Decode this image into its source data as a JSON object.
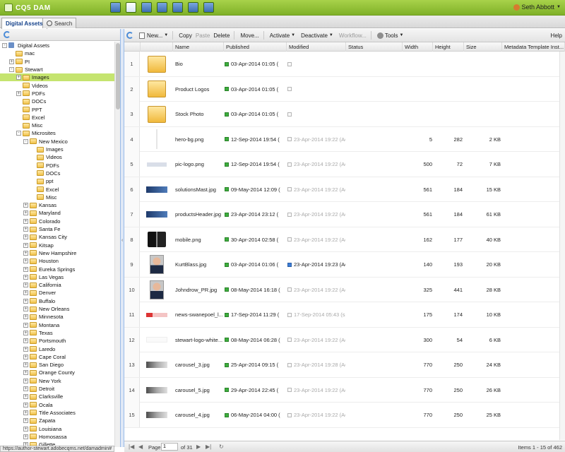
{
  "header": {
    "logo_text": "CQ5 DAM",
    "app_icons": [
      "welcome-icon",
      "dam-icon",
      "workflow-icon",
      "mail-icon",
      "images-icon",
      "tools-icon",
      "tags-icon"
    ],
    "user_name": "Seth Abbott"
  },
  "tabs": [
    {
      "label": "Digital Assets",
      "active": true
    },
    {
      "label": "Search",
      "active": false
    }
  ],
  "tree": {
    "nodes": [
      {
        "label": "Digital Assets",
        "level": 0,
        "expander": "-",
        "root": true
      },
      {
        "label": "mac",
        "level": 1,
        "expander": ""
      },
      {
        "label": "PI",
        "level": 1,
        "expander": "+"
      },
      {
        "label": "Stewart",
        "level": 1,
        "expander": "-"
      },
      {
        "label": "Images",
        "level": 2,
        "expander": "+",
        "selected": true
      },
      {
        "label": "Videos",
        "level": 2,
        "expander": ""
      },
      {
        "label": "PDFs",
        "level": 2,
        "expander": "+"
      },
      {
        "label": "DOCs",
        "level": 2,
        "expander": ""
      },
      {
        "label": "PPT",
        "level": 2,
        "expander": ""
      },
      {
        "label": "Excel",
        "level": 2,
        "expander": ""
      },
      {
        "label": "Misc",
        "level": 2,
        "expander": ""
      },
      {
        "label": "Microsites",
        "level": 2,
        "expander": "-"
      },
      {
        "label": "New Mexico",
        "level": 3,
        "expander": "-"
      },
      {
        "label": "Images",
        "level": 4,
        "expander": ""
      },
      {
        "label": "Videos",
        "level": 4,
        "expander": ""
      },
      {
        "label": "PDFs",
        "level": 4,
        "expander": ""
      },
      {
        "label": "DOCs",
        "level": 4,
        "expander": ""
      },
      {
        "label": "ppt",
        "level": 4,
        "expander": ""
      },
      {
        "label": "Excel",
        "level": 4,
        "expander": ""
      },
      {
        "label": "Misc",
        "level": 4,
        "expander": ""
      },
      {
        "label": "Kansas",
        "level": 3,
        "expander": "+"
      },
      {
        "label": "Maryland",
        "level": 3,
        "expander": "+"
      },
      {
        "label": "Colorado",
        "level": 3,
        "expander": "+"
      },
      {
        "label": "Santa Fe",
        "level": 3,
        "expander": "+"
      },
      {
        "label": "Kansas City",
        "level": 3,
        "expander": "+"
      },
      {
        "label": "Kitsap",
        "level": 3,
        "expander": "+"
      },
      {
        "label": "New Hampshire",
        "level": 3,
        "expander": "+"
      },
      {
        "label": "Houston",
        "level": 3,
        "expander": "+"
      },
      {
        "label": "Eureka Springs",
        "level": 3,
        "expander": "+"
      },
      {
        "label": "Las Vegas",
        "level": 3,
        "expander": "+"
      },
      {
        "label": "California",
        "level": 3,
        "expander": "+"
      },
      {
        "label": "Denver",
        "level": 3,
        "expander": "+"
      },
      {
        "label": "Buffalo",
        "level": 3,
        "expander": "+"
      },
      {
        "label": "New Orleans",
        "level": 3,
        "expander": "+"
      },
      {
        "label": "Minnesota",
        "level": 3,
        "expander": "+"
      },
      {
        "label": "Montana",
        "level": 3,
        "expander": "+"
      },
      {
        "label": "Texas",
        "level": 3,
        "expander": "+"
      },
      {
        "label": "Portsmouth",
        "level": 3,
        "expander": "+"
      },
      {
        "label": "Laredo",
        "level": 3,
        "expander": "+"
      },
      {
        "label": "Cape Coral",
        "level": 3,
        "expander": "+"
      },
      {
        "label": "San Diego",
        "level": 3,
        "expander": "+"
      },
      {
        "label": "Orange County",
        "level": 3,
        "expander": "+"
      },
      {
        "label": "New York",
        "level": 3,
        "expander": "+"
      },
      {
        "label": "Detroit",
        "level": 3,
        "expander": "+"
      },
      {
        "label": "Clarksville",
        "level": 3,
        "expander": "+"
      },
      {
        "label": "Ocala",
        "level": 3,
        "expander": "+"
      },
      {
        "label": "Title Associates",
        "level": 3,
        "expander": "+"
      },
      {
        "label": "Zapata",
        "level": 3,
        "expander": "+"
      },
      {
        "label": "Louisiana",
        "level": 3,
        "expander": "+"
      },
      {
        "label": "Homosassa",
        "level": 3,
        "expander": "+"
      },
      {
        "label": "Gillette",
        "level": 3,
        "expander": "+"
      }
    ]
  },
  "toolbar": {
    "new_label": "New...",
    "copy_label": "Copy",
    "paste_label": "Paste",
    "delete_label": "Delete",
    "move_label": "Move...",
    "activate_label": "Activate",
    "deactivate_label": "Deactivate",
    "workflow_label": "Workflow...",
    "tools_label": "Tools",
    "help_label": "Help"
  },
  "grid": {
    "columns": [
      "Name",
      "Published",
      "Modified",
      "Status",
      "Width",
      "Height",
      "Size",
      "Metadata Template Inst..."
    ],
    "rows": [
      {
        "num": "1",
        "thumb": "folder",
        "name": "Bio",
        "published": "03-Apr-2014 01:05 (",
        "modified": "",
        "modmark": "empty",
        "width": "",
        "height": "",
        "size": ""
      },
      {
        "num": "2",
        "thumb": "folder",
        "name": "Product Logos",
        "published": "03-Apr-2014 01:05 (",
        "modified": "",
        "modmark": "empty",
        "width": "",
        "height": "",
        "size": ""
      },
      {
        "num": "3",
        "thumb": "folder",
        "name": "Stock Photo",
        "published": "03-Apr-2014 01:05 (",
        "modified": "",
        "modmark": "empty",
        "width": "",
        "height": "",
        "size": ""
      },
      {
        "num": "4",
        "thumb": "blank",
        "name": "hero-bg.png",
        "published": "12-Sep-2014 19:54 (",
        "modified": "23-Apr-2014 19:22 (Ad",
        "modmark": "empty",
        "width": "5",
        "height": "282",
        "size": "2 KB"
      },
      {
        "num": "5",
        "thumb": "logo",
        "name": "pic-logo.png",
        "published": "12-Sep-2014 19:54 (",
        "modified": "23-Apr-2014 19:22 (Ad",
        "modmark": "empty",
        "width": "500",
        "height": "72",
        "size": "7 KB"
      },
      {
        "num": "6",
        "thumb": "banner",
        "name": "solutionsMast.jpg",
        "published": "09-May-2014 12:09 (",
        "modified": "23-Apr-2014 19:22 (Ad",
        "modmark": "empty",
        "width": "561",
        "height": "184",
        "size": "15 KB"
      },
      {
        "num": "7",
        "thumb": "banner",
        "name": "productsHeader.jpg",
        "published": "23-Apr-2014 23:12 (",
        "modified": "23-Apr-2014 19:22 (Ad",
        "modmark": "empty",
        "width": "561",
        "height": "184",
        "size": "61 KB"
      },
      {
        "num": "8",
        "thumb": "phone",
        "name": "mobile.png",
        "published": "30-Apr-2014 02:58 (",
        "modified": "23-Apr-2014 19:22 (Ad",
        "modmark": "empty",
        "width": "162",
        "height": "177",
        "size": "40 KB"
      },
      {
        "num": "9",
        "thumb": "person",
        "name": "KurtBlass.jpg",
        "published": "03-Apr-2014 01:06 (",
        "modified": "23-Apr-2014 19:23 (Ad",
        "modmark": "blue",
        "width": "140",
        "height": "193",
        "size": "20 KB"
      },
      {
        "num": "10",
        "thumb": "person",
        "name": "Johndrow_PR.jpg",
        "published": "08-May-2014 16:18 (",
        "modified": "23-Apr-2014 19:22 (Ad",
        "modmark": "empty",
        "width": "325",
        "height": "441",
        "size": "28 KB"
      },
      {
        "num": "11",
        "thumb": "swan",
        "name": "news-swanepoel_l...",
        "published": "17-Sep-2014 11:29 (",
        "modified": "17-Sep-2014 05:43 (ssi",
        "modmark": "empty",
        "width": "175",
        "height": "174",
        "size": "10 KB"
      },
      {
        "num": "12",
        "thumb": "white",
        "name": "stewart-logo-white...",
        "published": "08-May-2014 06:28 (",
        "modified": "23-Apr-2014 19:22 (Ad",
        "modmark": "empty",
        "width": "300",
        "height": "54",
        "size": "6 KB"
      },
      {
        "num": "13",
        "thumb": "car",
        "name": "carousel_3.jpg",
        "published": "25-Apr-2014 09:15 (",
        "modified": "23-Apr-2014 19:28 (Ad",
        "modmark": "empty",
        "width": "770",
        "height": "250",
        "size": "24 KB"
      },
      {
        "num": "14",
        "thumb": "car",
        "name": "carousel_5.jpg",
        "published": "29-Apr-2014 22:45 (",
        "modified": "23-Apr-2014 19:22 (Ad",
        "modmark": "empty",
        "width": "770",
        "height": "250",
        "size": "26 KB"
      },
      {
        "num": "15",
        "thumb": "car",
        "name": "carousel_4.jpg",
        "published": "06-May-2014 04:00 (",
        "modified": "23-Apr-2014 19:22 (Ad",
        "modmark": "empty",
        "width": "770",
        "height": "250",
        "size": "25 KB"
      }
    ]
  },
  "pager": {
    "page_label": "Page",
    "page_value": "1",
    "of_label": "of 31",
    "info": "Items 1 - 15 of 462"
  },
  "status_url": "https://author-stewart.adobecqms.net/damadmin#"
}
